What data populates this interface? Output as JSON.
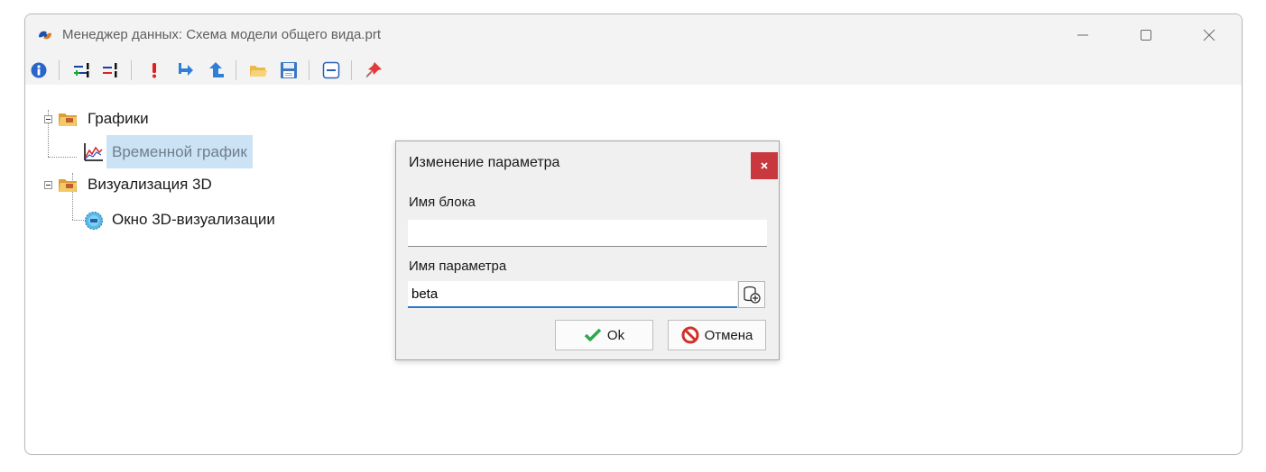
{
  "window": {
    "title": "Менеджер данных: Схема модели общего вида.prt",
    "app_icon": "sp-logo-icon",
    "controls": [
      "minimize-icon",
      "maximize-icon",
      "close-icon"
    ]
  },
  "toolbar": {
    "buttons": [
      {
        "name": "info",
        "icon": "info-icon"
      },
      {
        "name": "add-item",
        "icon": "add-link-icon"
      },
      {
        "name": "remove-item",
        "icon": "remove-link-icon"
      },
      {
        "name": "warning",
        "icon": "exclamation-icon"
      },
      {
        "name": "import",
        "icon": "arrow-right-icon"
      },
      {
        "name": "export",
        "icon": "arrow-up-icon"
      },
      {
        "name": "open",
        "icon": "folder-open-icon"
      },
      {
        "name": "save",
        "icon": "floppy-disk-icon"
      },
      {
        "name": "collapse",
        "icon": "collapse-icon"
      },
      {
        "name": "pin",
        "icon": "pin-icon"
      }
    ]
  },
  "tree": {
    "groups": [
      {
        "label": "Графики",
        "icon": "folder-group-icon",
        "children": [
          {
            "label": "Временной график",
            "icon": "time-chart-icon",
            "selected": true
          }
        ]
      },
      {
        "label": "Визуализация 3D",
        "icon": "folder-group-icon",
        "children": [
          {
            "label": "Окно 3D-визуализации",
            "icon": "3d-window-icon",
            "selected": false
          }
        ]
      }
    ]
  },
  "dialog": {
    "title": "Изменение параметра",
    "block_label": "Имя блока",
    "block_value": "",
    "param_label": "Имя параметра",
    "param_value": "beta",
    "ok_label": "Ok",
    "cancel_label": "Отмена"
  },
  "colors": {
    "selection": "#cce2f5",
    "dialog_close": "#c9383f",
    "focus_underline": "#2b78c6"
  }
}
